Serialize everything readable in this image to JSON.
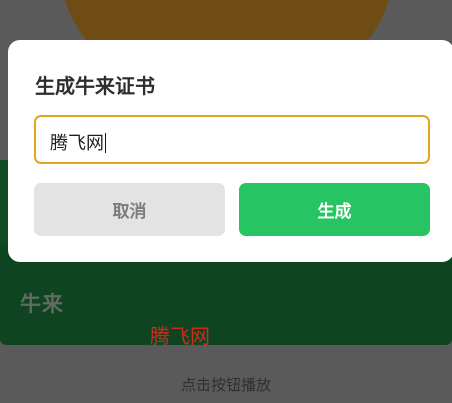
{
  "background": {
    "card_title": "牛来",
    "watermark": "腾飞网",
    "hint": "点击按钮播放"
  },
  "dialog": {
    "title": "生成牛来证书",
    "input": {
      "value": "腾飞网"
    },
    "cancel_label": "取消",
    "generate_label": "生成"
  },
  "colors": {
    "accent_green": "#26c462",
    "input_border": "#e3a51f",
    "card_green": "#0e4520",
    "watermark_red": "#c62f20"
  }
}
